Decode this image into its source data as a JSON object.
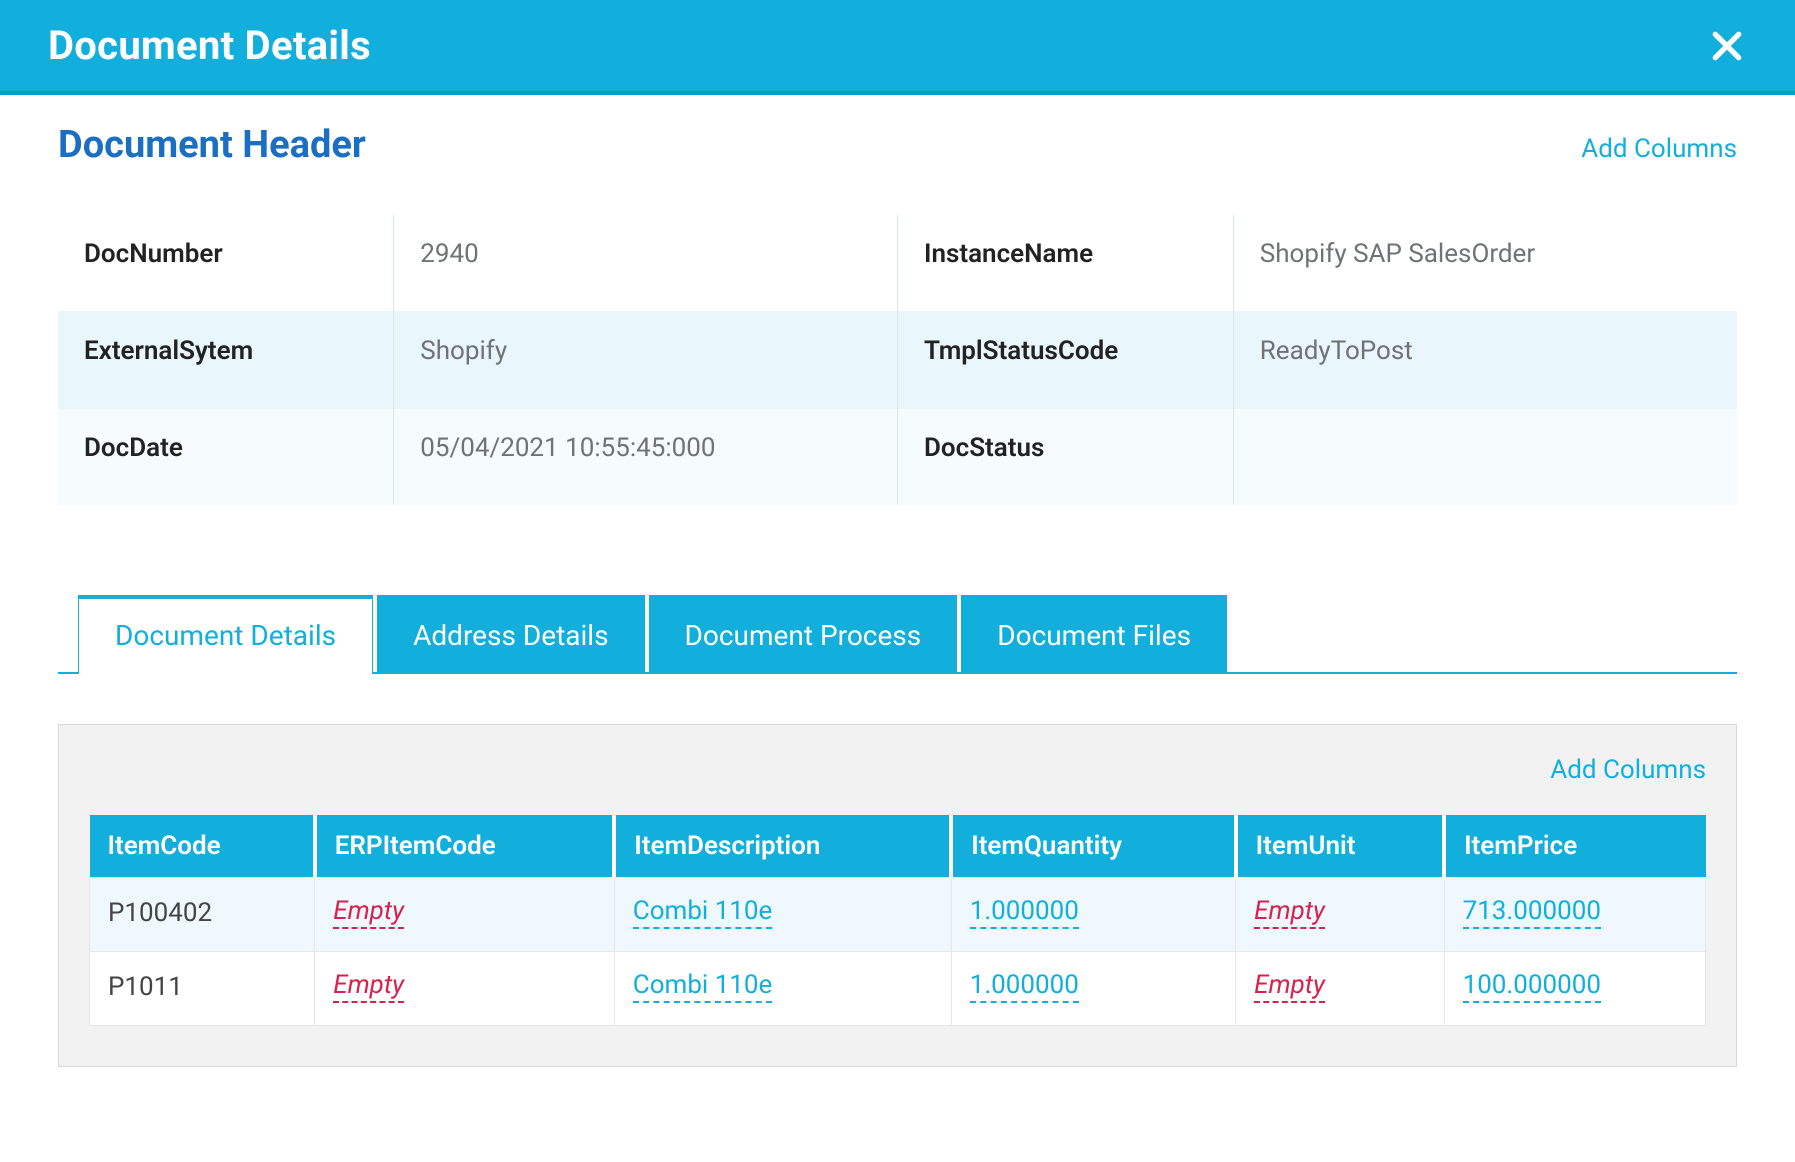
{
  "modal": {
    "title": "Document Details"
  },
  "header": {
    "title": "Document Header",
    "add_columns": "Add Columns",
    "rows": [
      {
        "k1": "DocNumber",
        "v1": "2940",
        "k2": "InstanceName",
        "v2": "Shopify SAP SalesOrder"
      },
      {
        "k1": "ExternalSytem",
        "v1": "Shopify",
        "k2": "TmplStatusCode",
        "v2": "ReadyToPost"
      },
      {
        "k1": "DocDate",
        "v1": "05/04/2021 10:55:45:000",
        "k2": "DocStatus",
        "v2": ""
      }
    ]
  },
  "tabs": [
    {
      "label": "Document Details",
      "active": true
    },
    {
      "label": "Address Details",
      "active": false
    },
    {
      "label": "Document Process",
      "active": false
    },
    {
      "label": "Document Files",
      "active": false
    }
  ],
  "details": {
    "add_columns": "Add Columns",
    "empty_label": "Empty",
    "columns": [
      "ItemCode",
      "ERPItemCode",
      "ItemDescription",
      "ItemQuantity",
      "ItemUnit",
      "ItemPrice"
    ],
    "rows": [
      {
        "ItemCode": "P100402",
        "ERPItemCode": "",
        "ItemDescription": "Combi 110e",
        "ItemQuantity": "1.000000",
        "ItemUnit": "",
        "ItemPrice": "713.000000"
      },
      {
        "ItemCode": "P1011",
        "ERPItemCode": "",
        "ItemDescription": "Combi 110e",
        "ItemQuantity": "1.000000",
        "ItemUnit": "",
        "ItemPrice": "100.000000"
      }
    ]
  }
}
